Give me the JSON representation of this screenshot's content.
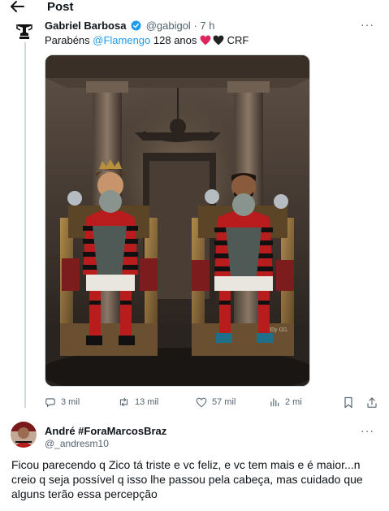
{
  "header": {
    "back_icon": "arrow-left-icon",
    "title": "Post"
  },
  "tweet": {
    "author_name": "Gabriel Barbosa",
    "handle": "@gabigol",
    "separator": "·",
    "time": "7 h",
    "text_prefix": "Parabéns ",
    "mention": "@Flamengo",
    "text_middle": " 128 anos ",
    "text_suffix": " CRF",
    "more": "···",
    "media_alt": "Two players seated on thrones holding trophies",
    "watermark": "Ely GG."
  },
  "actions": {
    "replies": "3 mil",
    "reposts": "13 mil",
    "likes": "57 mil",
    "views": "2 mi"
  },
  "reply": {
    "author_name": "André #ForaMarcosBraz",
    "handle": "@_andresm10",
    "more": "···",
    "text": "Ficou parecendo q Zico tá triste e vc feliz, e vc tem mais e é maior...n creio q seja possível q isso lhe passou pela cabeça, mas cuidado que alguns terão essa percepção"
  },
  "colors": {
    "accent": "#1d9bf0",
    "text": "#0f1419",
    "muted": "#536471",
    "heart_red": "#e0245e",
    "heart_black": "#222222"
  }
}
